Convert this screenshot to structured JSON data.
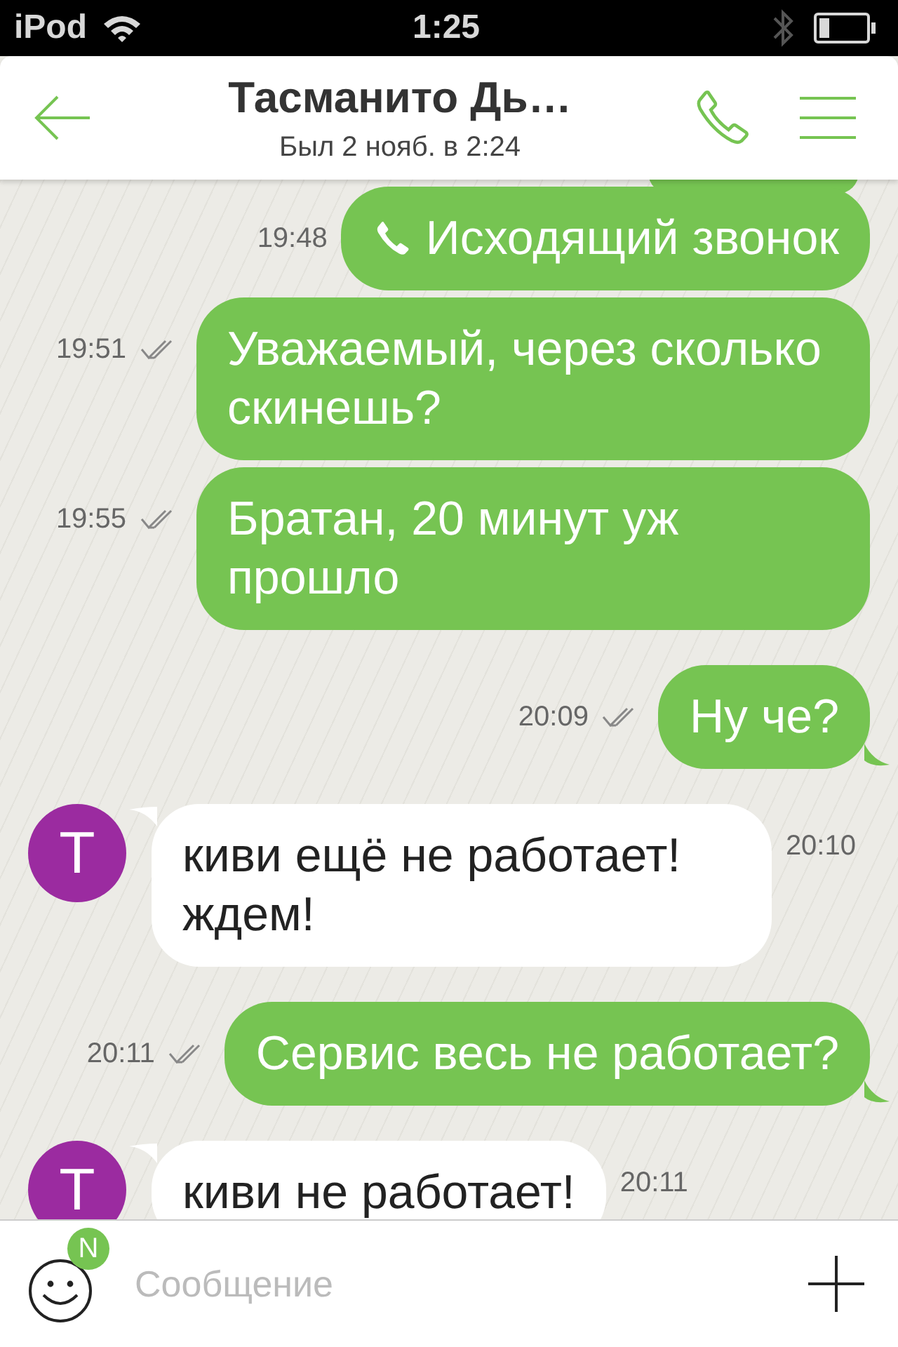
{
  "status_bar": {
    "carrier": "iPod",
    "time": "1:25"
  },
  "header": {
    "title": "Тасманито Дь…",
    "subtitle": "Был 2 нояб. в 2:24"
  },
  "messages": [
    {
      "kind": "call",
      "outgoing": true,
      "text": "Исходящий звонок",
      "time": "19:48",
      "read": false,
      "tail": false
    },
    {
      "kind": "text",
      "outgoing": true,
      "text": "Уважаемый, через сколько скинешь?",
      "time": "19:51",
      "read": true,
      "tail": false
    },
    {
      "kind": "text",
      "outgoing": true,
      "text": "Братан, 20 минут уж прошло",
      "time": "19:55",
      "read": true,
      "tail": false
    },
    {
      "kind": "text",
      "outgoing": true,
      "text": "Ну че?",
      "time": "20:09",
      "read": true,
      "tail": true
    },
    {
      "kind": "text",
      "outgoing": false,
      "avatar": "Т",
      "text": "киви ещё не работает! ждем!",
      "time": "20:10",
      "tail": true
    },
    {
      "kind": "text",
      "outgoing": true,
      "text": "Сервис весь не работает?",
      "time": "20:11",
      "read": true,
      "tail": true
    },
    {
      "kind": "text",
      "outgoing": false,
      "avatar": "Т",
      "text": "киви не работает!",
      "time": "20:11",
      "tail": true
    }
  ],
  "composer": {
    "placeholder": "Сообщение",
    "badge": "N"
  }
}
